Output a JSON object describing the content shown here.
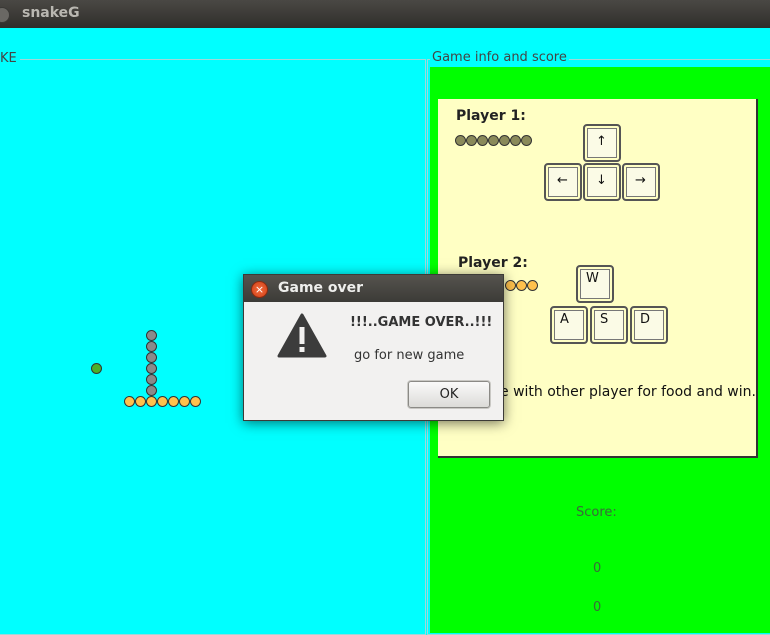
{
  "window": {
    "title": "snakeG"
  },
  "game_panel": {
    "label": "KE",
    "food_color": "#4caf2a",
    "snake1_color": "#8a8a8a",
    "snake2_color": "#ffc14d"
  },
  "info_panel": {
    "label": "Game info and score",
    "player1": {
      "label": "Player 1:",
      "lives": 7,
      "keys": [
        "↑",
        "←",
        "↓",
        "→"
      ]
    },
    "player2": {
      "label": "Player 2:",
      "lives": 3,
      "keys": [
        "W",
        "A",
        "S",
        "D"
      ]
    },
    "rules_text": "e with other player for food and win.",
    "score_label": "Score:",
    "scores": [
      "0",
      "0"
    ]
  },
  "dialog": {
    "title": "Game over",
    "message_title": "!!!..GAME OVER..!!!",
    "message_body": "go for new game",
    "ok_label": "OK"
  },
  "colors": {
    "game_bg": "#00ffff",
    "info_bg": "#00ff00",
    "card_bg": "#ffffc4"
  }
}
